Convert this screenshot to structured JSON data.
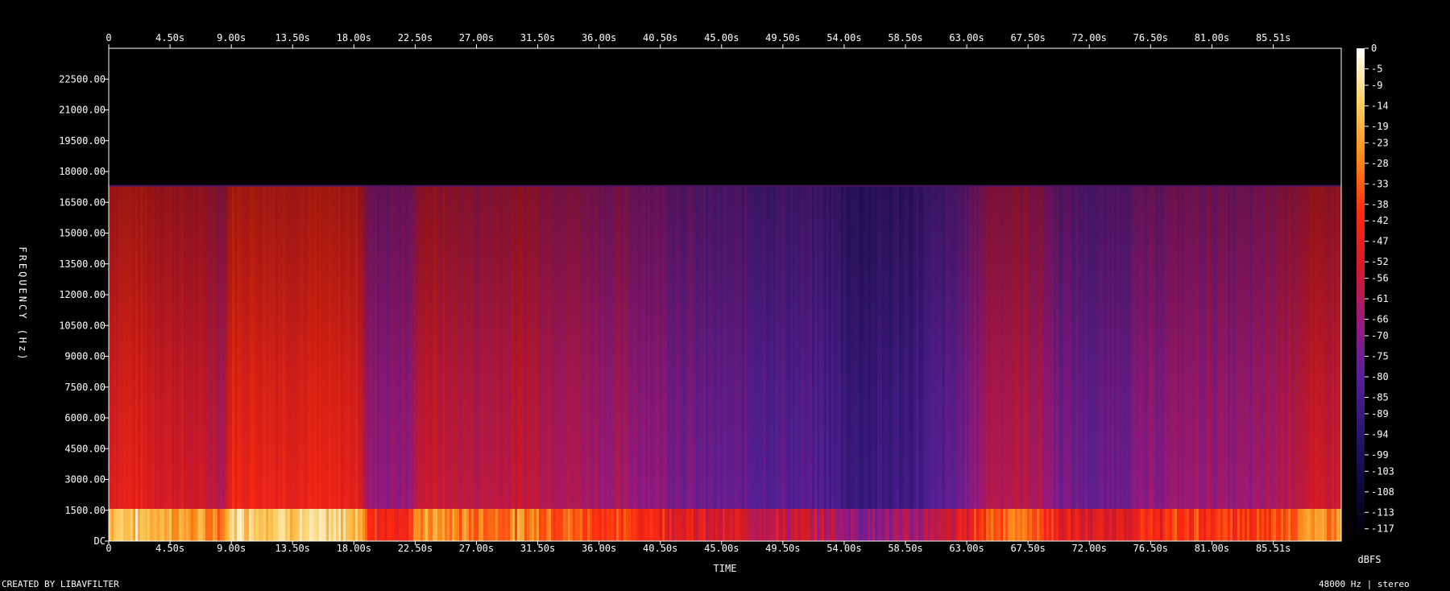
{
  "footer": {
    "created_by": "CREATED BY LIBAVFILTER",
    "sample_info": "48000 Hz | stereo"
  },
  "chart_data": {
    "type": "heatmap",
    "title": "",
    "xlabel": "TIME",
    "ylabel": "FREQUENCY (Hz)",
    "colorbar_label": "dBFS",
    "x_ticks": [
      "0",
      "4.50s",
      "9.00s",
      "13.50s",
      "18.00s",
      "22.50s",
      "27.00s",
      "31.50s",
      "36.00s",
      "40.50s",
      "45.00s",
      "49.50s",
      "54.00s",
      "58.50s",
      "63.00s",
      "67.50s",
      "72.00s",
      "76.50s",
      "81.00s",
      "85.51s"
    ],
    "x_tick_values": [
      0,
      4.5,
      9,
      13.5,
      18,
      22.5,
      27,
      31.5,
      36,
      40.5,
      45,
      49.5,
      54,
      58.5,
      63,
      67.5,
      72,
      76.5,
      81,
      85.51
    ],
    "xlim": [
      0,
      90.5
    ],
    "y_ticks": [
      "DC",
      "1500.00",
      "3000.00",
      "4500.00",
      "6000.00",
      "7500.00",
      "9000.00",
      "10500.00",
      "12000.00",
      "13500.00",
      "15000.00",
      "16500.00",
      "18000.00",
      "19500.00",
      "21000.00",
      "22500.00"
    ],
    "y_tick_values": [
      0,
      1500,
      3000,
      4500,
      6000,
      7500,
      9000,
      10500,
      12000,
      13500,
      15000,
      16500,
      18000,
      19500,
      21000,
      22500
    ],
    "ylim": [
      0,
      24000
    ],
    "lowpass_cutoff_hz": 17300,
    "colorbar_ticks": [
      0,
      -5,
      -9,
      -14,
      -19,
      -23,
      -28,
      -33,
      -38,
      -42,
      -47,
      -52,
      -56,
      -61,
      -66,
      -70,
      -75,
      -80,
      -85,
      -89,
      -94,
      -99,
      -103,
      -108,
      -113,
      -117
    ],
    "colorbar_range": [
      -120,
      0
    ],
    "colormap": [
      "#000000",
      "#0a0a3a",
      "#2a1670",
      "#55209a",
      "#9a1a80",
      "#d41a2a",
      "#ff2a10",
      "#ff8a18",
      "#ffd060",
      "#ffffff"
    ],
    "intensity_profile": [
      {
        "t": 0.0,
        "level": 0.88
      },
      {
        "t": 1.0,
        "level": 0.92
      },
      {
        "t": 5.0,
        "level": 0.82
      },
      {
        "t": 8.5,
        "level": 0.72
      },
      {
        "t": 9.0,
        "level": 0.96
      },
      {
        "t": 14.0,
        "level": 0.93
      },
      {
        "t": 18.5,
        "level": 0.9
      },
      {
        "t": 19.0,
        "level": 0.6
      },
      {
        "t": 22.0,
        "level": 0.58
      },
      {
        "t": 23.0,
        "level": 0.8
      },
      {
        "t": 27.0,
        "level": 0.72
      },
      {
        "t": 31.0,
        "level": 0.75
      },
      {
        "t": 35.0,
        "level": 0.66
      },
      {
        "t": 40.0,
        "level": 0.58
      },
      {
        "t": 44.0,
        "level": 0.45
      },
      {
        "t": 48.0,
        "level": 0.42
      },
      {
        "t": 52.0,
        "level": 0.38
      },
      {
        "t": 55.0,
        "level": 0.26
      },
      {
        "t": 59.0,
        "level": 0.3
      },
      {
        "t": 62.0,
        "level": 0.42
      },
      {
        "t": 65.0,
        "level": 0.72
      },
      {
        "t": 68.0,
        "level": 0.7
      },
      {
        "t": 70.0,
        "level": 0.5
      },
      {
        "t": 73.0,
        "level": 0.44
      },
      {
        "t": 76.0,
        "level": 0.55
      },
      {
        "t": 80.0,
        "level": 0.62
      },
      {
        "t": 84.0,
        "level": 0.58
      },
      {
        "t": 87.0,
        "level": 0.74
      },
      {
        "t": 90.5,
        "level": 0.8
      }
    ]
  }
}
